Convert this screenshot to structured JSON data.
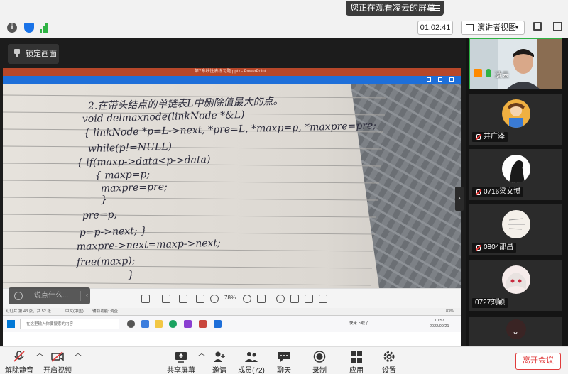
{
  "banner": {
    "share_notice": "您正在观看凌云的屏幕"
  },
  "toolbar": {
    "timer": "01:02:41",
    "view_mode": "演讲者视图"
  },
  "stage": {
    "lock_label": "锁定画面",
    "ppt_title": "第7章线性表练习题.pptx - PowerPoint",
    "zoom": "78%",
    "chat_placeholder": "说点什么...",
    "status_left": "幻灯片 第 43 张，共 52 张",
    "status_lang": "中文(中国)",
    "status_access": "辅助功能: 调查",
    "status_zoom": "83%",
    "taskbar_search": "在这里输入你要搜索的内容",
    "tray_text": "快来下载了",
    "clock_time": "10:57",
    "clock_date": "2022/09/21",
    "handwriting": [
      "2.在带头结点的单链表L中删除值最大的点。",
      "void delmaxnode(linkNode *&L)",
      "{ linkNode *p=L->next, *pre=L, *maxp=p, *maxpre=pre;",
      "while(p!=NULL)",
      "{ if(maxp->data<p->data)",
      "{ maxp=p;",
      "maxpre=pre;",
      "}",
      "pre=p;",
      "p=p->next; }",
      "maxpre->next=maxp->next;",
      "free(maxp);",
      "}"
    ]
  },
  "participants": [
    {
      "name": "凌云"
    },
    {
      "name": "井广泽"
    },
    {
      "name": "0716梁文博"
    },
    {
      "name": "0804邵昌"
    },
    {
      "name": "0727刘颖"
    }
  ],
  "bottombar": {
    "unmute": "解除静音",
    "start_video": "开启视频",
    "share_screen": "共享屏幕",
    "invite": "邀请",
    "members": "成员(72)",
    "chat": "聊天",
    "record": "录制",
    "apps": "应用",
    "settings": "设置",
    "leave": "离开会议"
  },
  "colors": {
    "accent_blue": "#1e6fd9",
    "leave_red": "#e03c3c",
    "ppt_red": "#b7472a",
    "active_green": "#2fb344"
  }
}
